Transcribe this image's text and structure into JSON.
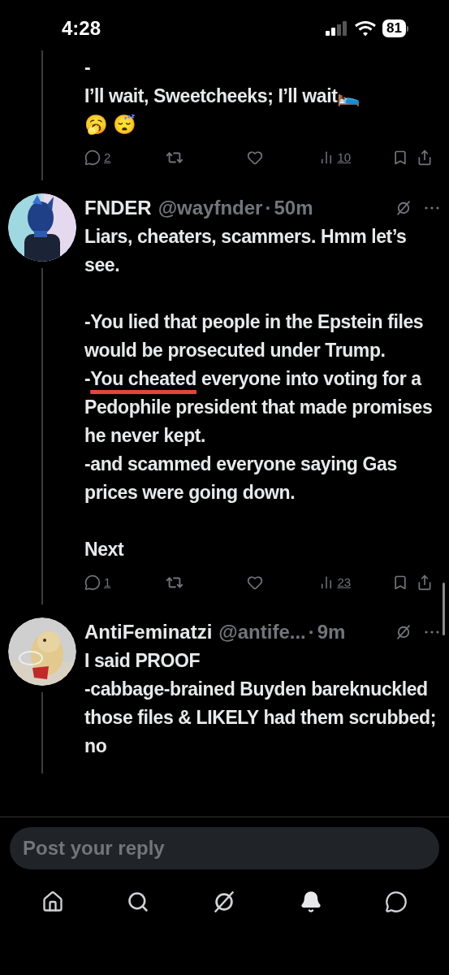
{
  "status_bar": {
    "time": "4:28",
    "battery": "81"
  },
  "posts": [
    {
      "kind": "continuation",
      "blocks": [
        [
          [
            {
              "text": "-"
            }
          ],
          [
            {
              "text": "I’ll wait, Sweetcheeks; I’ll wait🛌"
            }
          ],
          [
            {
              "text": "🥱 😴"
            }
          ]
        ]
      ],
      "actions": {
        "replies": "2",
        "views": "10"
      }
    },
    {
      "kind": "reply",
      "author": {
        "name": "FNDER",
        "handle": "@wayfnder",
        "separator": "·",
        "time": "50m"
      },
      "avatar": {
        "kind": "picture"
      },
      "blocks": [
        [
          [
            {
              "text": "Liars, cheaters, scammers. Hmm let’s see."
            }
          ]
        ],
        [
          [
            {
              "text": "-You lied that people in the Epstein files would be prosecuted under Trump."
            }
          ],
          [
            {
              "text": "-"
            },
            {
              "text": "You cheated",
              "underlined": true
            },
            {
              "text": " everyone into voting for a Pedophile president that made promises he never kept."
            }
          ],
          [
            {
              "text": "-and scammed everyone saying Gas prices were going down."
            }
          ]
        ],
        [
          [
            {
              "text": "Next"
            }
          ]
        ]
      ],
      "actions": {
        "replies": "1",
        "views": "23"
      }
    },
    {
      "kind": "reply",
      "author": {
        "name": "AntiFeminatzi",
        "handle": "@antife...",
        "separator": "·",
        "time": "9m"
      },
      "avatar": {
        "kind": "picture"
      },
      "blocks": [
        [
          [
            {
              "text": "I said PROOF"
            }
          ],
          [
            {
              "text": "-cabbage-brained Buyden bareknuckled those files & LIKELY had them scrubbed; no"
            }
          ]
        ]
      ]
    }
  ],
  "reply_field": {
    "placeholder": "Post your reply"
  },
  "nav": [
    {
      "kind": "home",
      "selected": false
    },
    {
      "kind": "search",
      "selected": false
    },
    {
      "kind": "grok",
      "selected": false
    },
    {
      "kind": "notifications",
      "selected": true
    },
    {
      "kind": "messages",
      "selected": false
    }
  ]
}
